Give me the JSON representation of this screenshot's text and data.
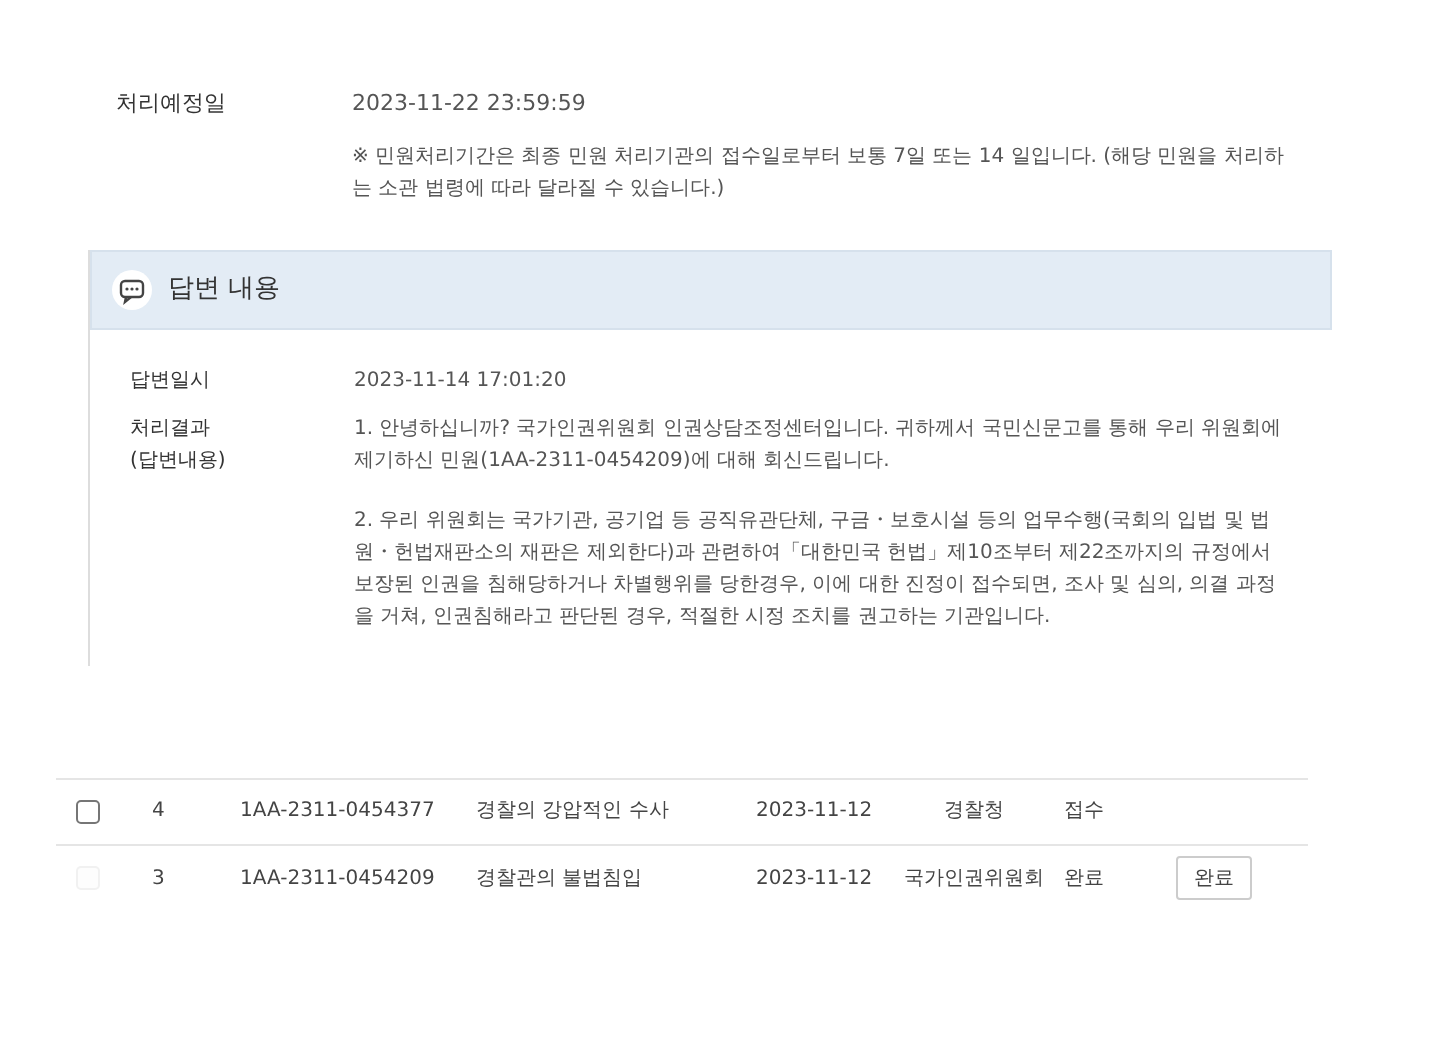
{
  "schedule": {
    "label": "처리예정일",
    "value": "2023-11-22 23:59:59",
    "note": "※ 민원처리기간은 최종 민원 처리기관의 접수일로부터 보통 7일 또는 14 일입니다. (해당 민원을 처리하는 소관 법령에 따라 달라질 수 있습니다.)"
  },
  "answer": {
    "title": "답변 내용",
    "fields": [
      {
        "label": "답변일시",
        "paragraphs": [
          "2023-11-14 17:01:20"
        ]
      },
      {
        "label": "처리결과\n(답변내용)",
        "paragraphs": [
          "1. 안녕하십니까? 국가인권위원회 인권상담조정센터입니다. 귀하께서 국민신문고를 통해 우리 위원회에 제기하신 민원(1AA-2311-0454209)에 대해 회신드립니다.",
          "2. 우리 위원회는 국가기관, 공기업 등 공직유관단체, 구금・보호시설 등의 업무수행(국회의 입법 및 법원・헌법재판소의 재판은 제외한다)과 관련하여「대한민국 헌법」제10조부터 제22조까지의 규정에서 보장된 인권을 침해당하거나 차별행위를 당한경우, 이에 대한 진정이 접수되면, 조사 및 심의, 의결 과정을 거쳐, 인권침해라고 판단된 경우, 적절한 시정 조치를 권고하는 기관입니다."
        ]
      }
    ]
  },
  "table": {
    "rows": [
      {
        "checked": false,
        "disabled": false,
        "no": "4",
        "id": "1AA-2311-0454377",
        "title": "경찰의 강압적인 수사",
        "date": "2023-11-12",
        "agency": "경찰청",
        "status": "접수"
      },
      {
        "checked": false,
        "disabled": true,
        "no": "3",
        "id": "1AA-2311-0454209",
        "title": "경찰관의 불법침입",
        "date": "2023-11-12",
        "agency": "국가인권위원회",
        "status": "완료",
        "button": "완료"
      }
    ]
  }
}
